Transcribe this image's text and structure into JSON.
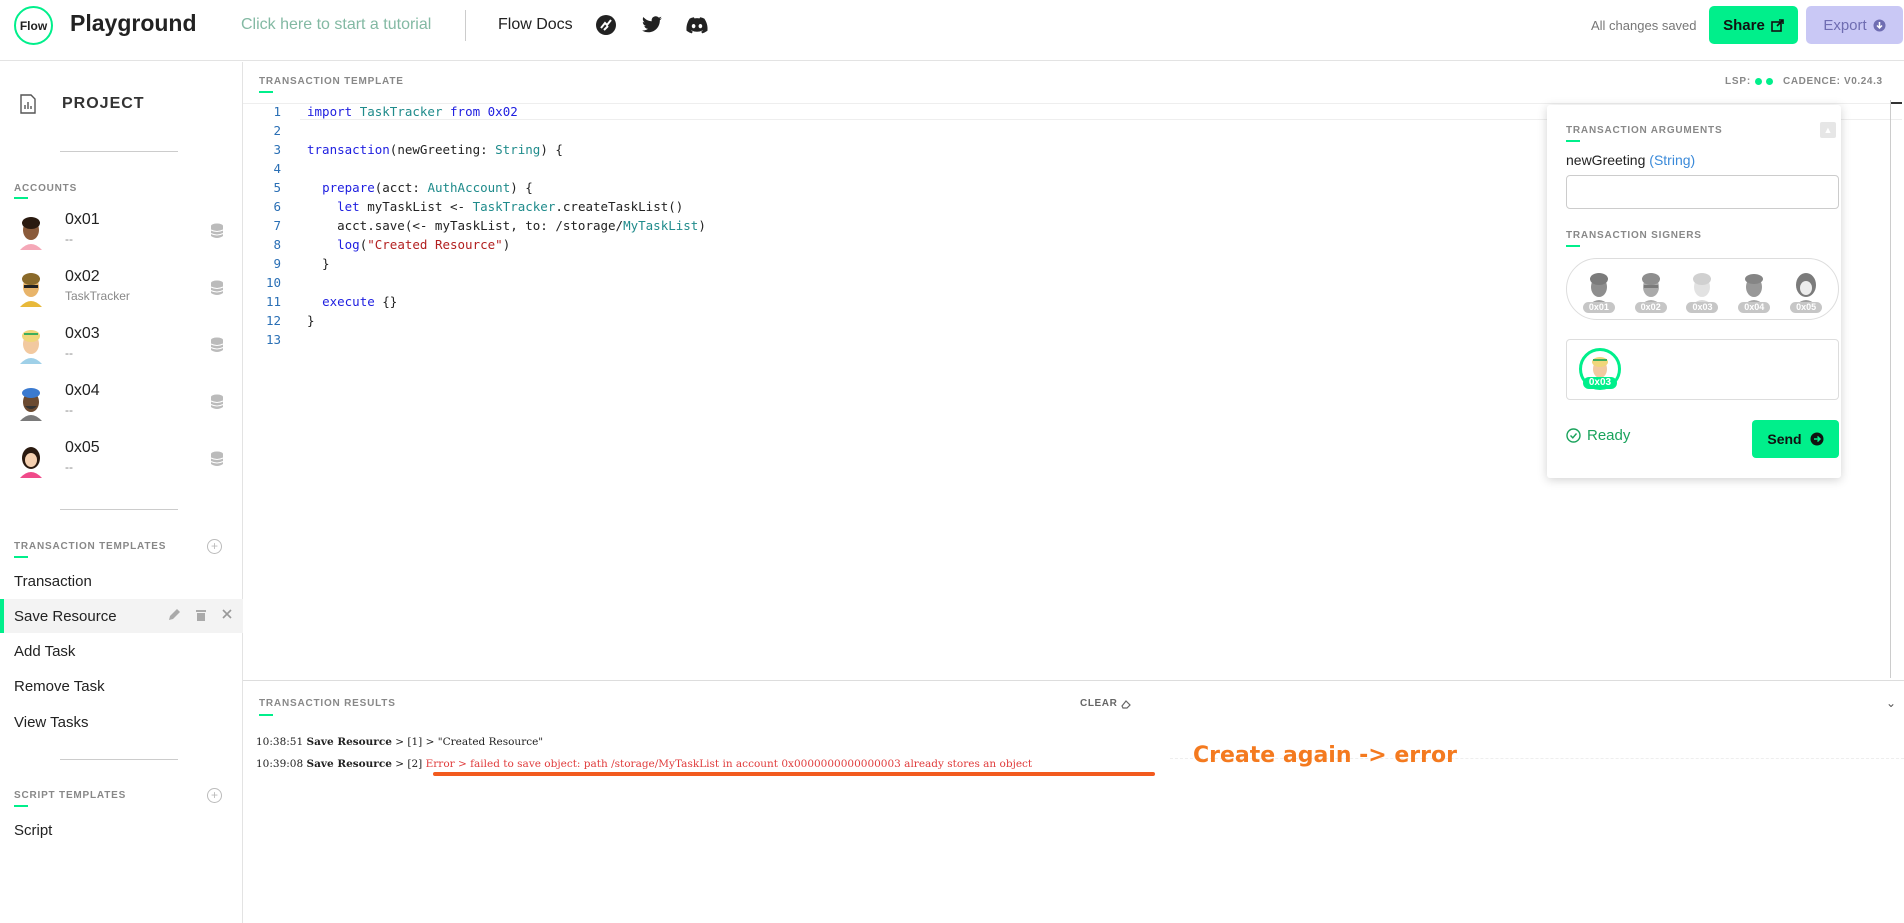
{
  "header": {
    "logo_text": "Flow",
    "app_title": "Playground",
    "tutorial_link": "Click here to start a tutorial",
    "docs_link": "Flow Docs",
    "icons": [
      "flow-docs-runner-icon",
      "twitter-icon",
      "discord-icon"
    ],
    "saved_status": "All changes saved",
    "share_label": "Share",
    "export_label": "Export"
  },
  "sidebar": {
    "project_label": "PROJECT",
    "accounts_title": "ACCOUNTS",
    "accounts": [
      {
        "address": "0x01",
        "sub": "--"
      },
      {
        "address": "0x02",
        "sub": "TaskTracker"
      },
      {
        "address": "0x03",
        "sub": "--"
      },
      {
        "address": "0x04",
        "sub": "--"
      },
      {
        "address": "0x05",
        "sub": "--"
      }
    ],
    "tx_templates_title": "TRANSACTION TEMPLATES",
    "tx_templates": [
      "Transaction",
      "Save Resource",
      "Add Task",
      "Remove Task",
      "View Tasks"
    ],
    "active_template": "Save Resource",
    "script_templates_title": "SCRIPT TEMPLATES",
    "script_templates": [
      "Script"
    ]
  },
  "editor": {
    "title": "TRANSACTION TEMPLATE",
    "lsp_label": "LSP:",
    "cadence_label": "CADENCE: V0.24.3"
  },
  "args_panel": {
    "arguments_title": "TRANSACTION ARGUMENTS",
    "arg_name": "newGreeting",
    "arg_type": "(String)",
    "arg_value": "",
    "signers_title": "TRANSACTION SIGNERS",
    "signers": [
      "0x01",
      "0x02",
      "0x03",
      "0x04",
      "0x05"
    ],
    "selected_signer": "0x03",
    "status": "Ready",
    "send_label": "Send"
  },
  "results": {
    "title": "TRANSACTION RESULTS",
    "clear_label": "CLEAR",
    "lines": [
      {
        "time": "10:38:51",
        "template": "Save Resource",
        "index": "[1]",
        "message": "\"Created Resource\""
      },
      {
        "time": "10:39:08",
        "template": "Save Resource",
        "index": "[2]",
        "error_label": "Error",
        "message": "failed to save object: path /storage/MyTaskList in account 0x0000000000000003 already stores an object"
      }
    ],
    "annotation": "Create again -> error"
  },
  "colors": {
    "accent": "#00ef8b",
    "export_bg": "#c9c8f5",
    "error": "#e03c3c",
    "annotation": "#f47a1f"
  }
}
